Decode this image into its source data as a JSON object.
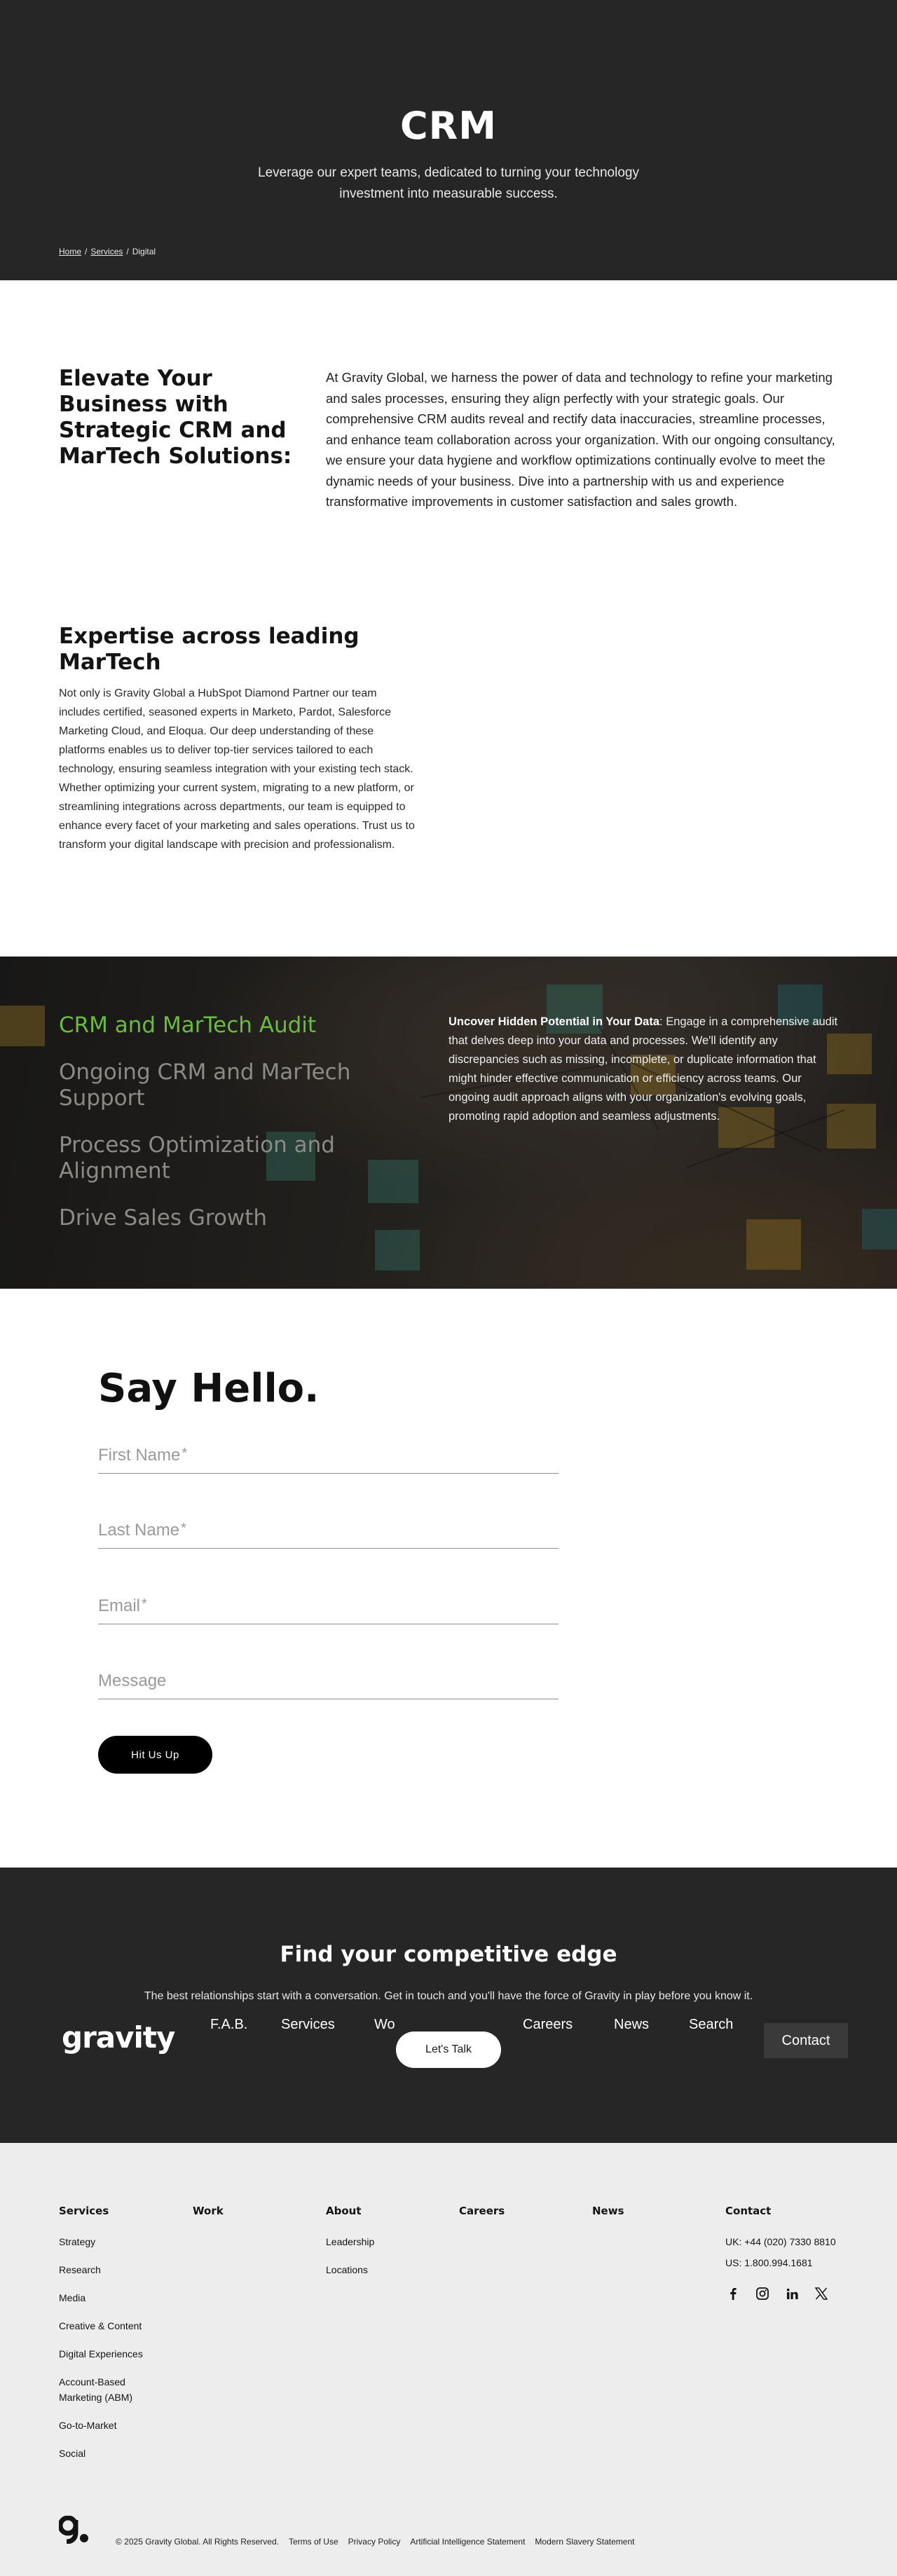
{
  "hero": {
    "title": "CRM",
    "subtitle": "Leverage our expert teams, dedicated to turning your technology investment into measurable success.",
    "breadcrumb": [
      "Home",
      "Services",
      "Digital"
    ]
  },
  "elevate": {
    "heading": "Elevate Your Business with Strategic CRM and MarTech Solutions:",
    "body": "At Gravity Global, we harness the power of data and technology to refine your marketing and sales processes, ensuring they align perfectly with your strategic goals. Our comprehensive CRM audits reveal and rectify data inaccuracies, streamline processes, and enhance team collaboration across your organization. With our ongoing consultancy, we ensure your data hygiene and workflow optimizations continually evolve to meet the dynamic needs of your business. Dive into a partnership with us and experience transformative improvements in customer satisfaction and sales growth."
  },
  "expertise": {
    "heading": "Expertise across leading MarTech",
    "body": "Not only is Gravity Global a HubSpot Diamond Partner our team includes certified, seasoned  experts in Marketo, Pardot, Salesforce Marketing Cloud, and Eloqua. Our deep understanding of these platforms enables us to deliver top-tier services tailored to each technology, ensuring seamless integration with your existing tech stack. Whether optimizing your current system, migrating to a new platform, or streamlining integrations across departments, our team is equipped to enhance every facet of your marketing and sales operations. Trust us to transform your digital landscape with precision and professionalism."
  },
  "audit": {
    "tabs": [
      "CRM and MarTech Audit",
      "Ongoing CRM and MarTech Support",
      "Process Optimization and Alignment",
      "Drive Sales Growth"
    ],
    "active_tab": 0,
    "active_color": "#6abb3e",
    "detail_title": "Uncover Hidden Potential in Your Data",
    "detail_body": ": Engage in a comprehensive audit that delves deep into your data and processes. We'll identify any discrepancies such as missing, incomplete, or duplicate information that might hinder effective communication or efficiency across teams. Our ongoing audit approach aligns with your organization's evolving goals, promoting rapid adoption and seamless adjustments."
  },
  "hello": {
    "heading": "Say Hello.",
    "fields": {
      "first_name": "First Name",
      "last_name": "Last Name",
      "email": "Email",
      "message": "Message",
      "required_mark": "*"
    },
    "submit_label": "Hit Us Up"
  },
  "edge": {
    "heading": "Find your competitive edge",
    "body": "The best relationships start with a conversation. Get in touch and you'll have the force of Gravity in play before you know it.",
    "logo": "gravity",
    "nav": [
      "F.A.B.",
      "Services",
      "Wo",
      "Careers",
      "News",
      "Search"
    ],
    "talk_label": "Let's Talk",
    "contact_label": "Contact"
  },
  "footer": {
    "services": {
      "heading": "Services",
      "links": [
        "Strategy",
        "Research",
        "Media",
        "Creative & Content",
        "Digital Experiences",
        "Account-Based Marketing (ABM)",
        "Go-to-Market",
        "Social"
      ]
    },
    "work": {
      "heading": "Work"
    },
    "about": {
      "heading": "About",
      "links": [
        "Leadership",
        "Locations"
      ]
    },
    "careers": {
      "heading": "Careers"
    },
    "news": {
      "heading": "News"
    },
    "contact": {
      "heading": "Contact",
      "uk": "UK: +44 (020) 7330 8810",
      "us": "US: 1.800.994.1681"
    },
    "socials": [
      "facebook-icon",
      "instagram-icon",
      "linkedin-icon",
      "x-icon"
    ],
    "copyright": "© 2025 Gravity Global. All Rights Reserved.",
    "legal": [
      "Terms of Use",
      "Privacy Policy",
      "Artificial Intelligence Statement",
      "Modern Slavery Statement"
    ]
  }
}
